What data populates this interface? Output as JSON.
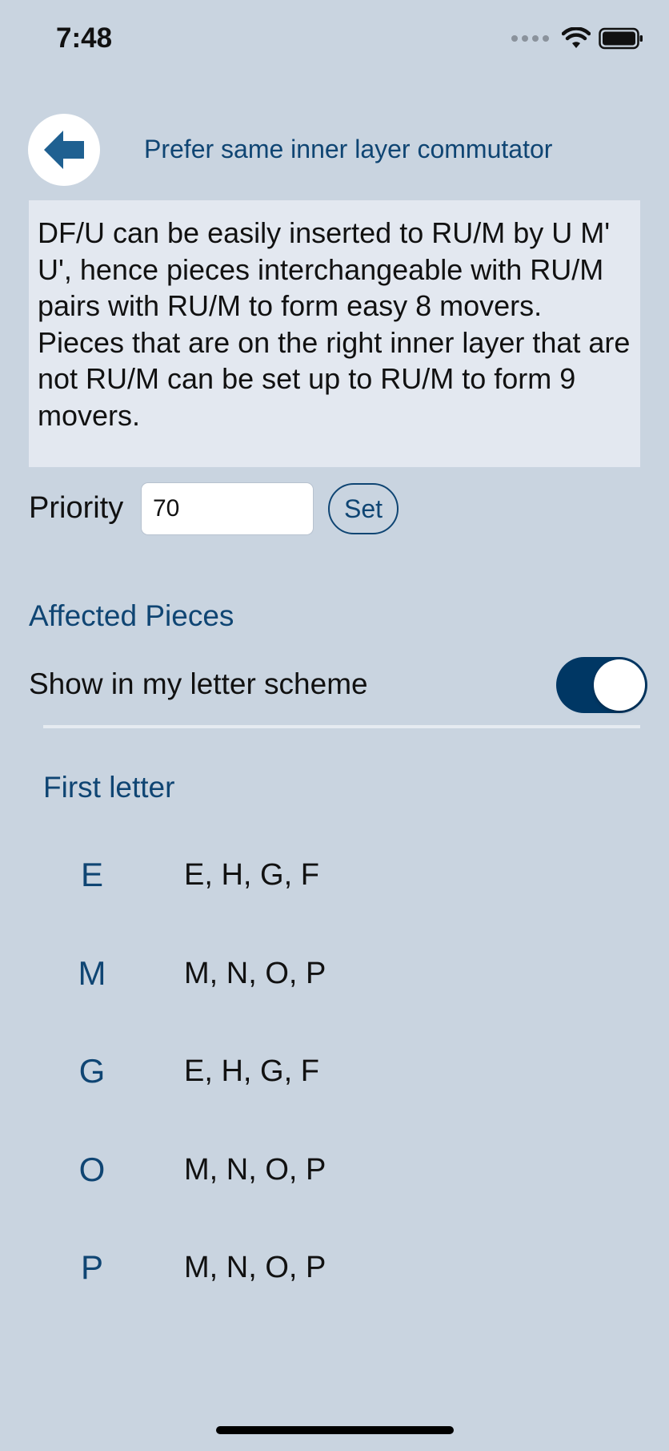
{
  "status_bar": {
    "time": "7:48"
  },
  "header": {
    "back_icon": "arrow-left-icon",
    "title": "Prefer same inner layer commutator"
  },
  "description": "DF/U can be easily inserted to RU/M by U M' U', hence pieces interchangeable with RU/M pairs with RU/M to form easy 8 movers. Pieces that are on the right inner layer that are not RU/M can be set up to RU/M to form 9 movers.",
  "priority": {
    "label": "Priority",
    "value": "70",
    "set_label": "Set"
  },
  "affected": {
    "heading": "Affected Pieces",
    "toggle_label": "Show in my letter scheme",
    "toggle_on": true,
    "subheading": "First letter",
    "pieces": [
      {
        "letter": "E",
        "values": "E, H, G, F"
      },
      {
        "letter": "M",
        "values": "M, N, O, P"
      },
      {
        "letter": "G",
        "values": "E, H, G, F"
      },
      {
        "letter": "O",
        "values": "M, N, O, P"
      },
      {
        "letter": "P",
        "values": "M, N, O, P"
      }
    ]
  },
  "colors": {
    "background": "#c9d4e0",
    "accent": "#0f4573",
    "toggle_on": "#003764",
    "description_background": "#e3e8f0"
  }
}
